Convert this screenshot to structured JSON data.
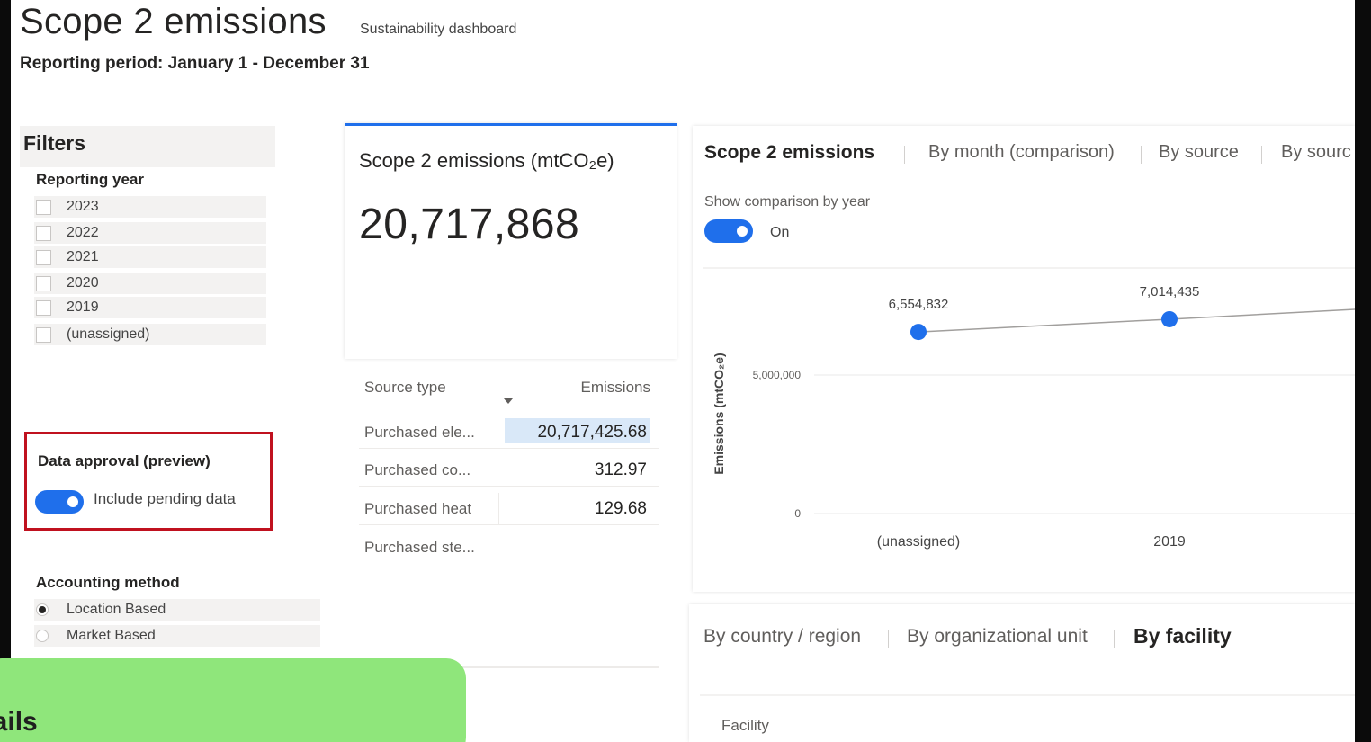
{
  "header": {
    "title": "Scope 2 emissions",
    "subtitle": "Sustainability dashboard",
    "reporting_period": "Reporting period: January 1 - December 31"
  },
  "filters": {
    "header": "Filters",
    "reporting_year_label": "Reporting year",
    "years": [
      "2023",
      "2022",
      "2021",
      "2020",
      "2019",
      "(unassigned)"
    ],
    "data_approval": {
      "title": "Data approval (preview)",
      "toggle_label": "Include pending data",
      "toggle_on": true
    },
    "accounting_method_label": "Accounting method",
    "accounting_methods": [
      {
        "label": "Location Based",
        "selected": true
      },
      {
        "label": "Market Based",
        "selected": false
      }
    ]
  },
  "kpi": {
    "title": "Scope 2 emissions (mtCO₂e)",
    "value": "20,717,868"
  },
  "source_table": {
    "col_source": "Source type",
    "col_emissions": "Emissions",
    "rows": [
      {
        "type": "Purchased ele...",
        "value": "20,717,425.68",
        "highlight": true
      },
      {
        "type": "Purchased co...",
        "value": "312.97",
        "highlight": false
      },
      {
        "type": "Purchased heat",
        "value": "129.68",
        "highlight": false
      },
      {
        "type": "Purchased ste...",
        "value": "",
        "highlight": false
      }
    ]
  },
  "chart_panel": {
    "tabs": [
      "Scope 2 emissions",
      "By month (comparison)",
      "By source",
      "By sourc"
    ],
    "active_tab": "Scope 2 emissions",
    "show_comparison_label": "Show comparison by year",
    "toggle_label": "On",
    "toggle_on": true
  },
  "chart_data": {
    "type": "line",
    "title": "",
    "xlabel": "",
    "ylabel": "Emissions (mtCO₂e)",
    "categories": [
      "(unassigned)",
      "2019"
    ],
    "values": [
      6554832,
      7014435
    ],
    "data_labels": [
      "6,554,832",
      "7,014,435"
    ],
    "y_ticks": [
      0,
      5000000
    ],
    "y_tick_labels": [
      "0",
      "5,000,000"
    ],
    "ylim": [
      0,
      7500000
    ],
    "color": "#1f6feb",
    "grid": true
  },
  "bottom_panel": {
    "tabs": [
      "By country / region",
      "By organizational unit",
      "By facility"
    ],
    "active_tab": "By facility",
    "column_header": "Facility"
  },
  "overlay": {
    "text": "rails",
    "color": "#8fe67b"
  }
}
